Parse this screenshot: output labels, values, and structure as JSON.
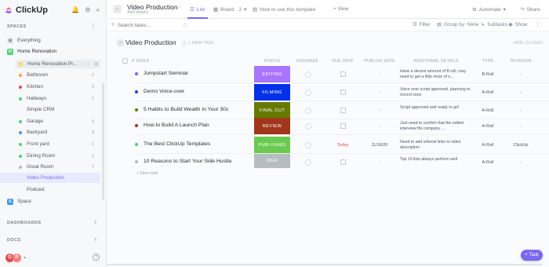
{
  "app": {
    "name": "ClickUp",
    "accent": "#7b68ee"
  },
  "sidebar": {
    "spaces_label": "SPACES",
    "everything": "Everything",
    "space_name": "Home Renovation",
    "space_initial": "H",
    "folder": "Home Renovation Pr...",
    "lists": [
      {
        "label": "Bathroom",
        "count": "2",
        "color": "#f9a33d"
      },
      {
        "label": "Kitchen",
        "count": "3",
        "color": "#e44c4c"
      },
      {
        "label": "Hallways",
        "count": "1",
        "color": "#4bd37b"
      },
      {
        "label": "Simple CRM",
        "count": "",
        "color": ""
      },
      {
        "label": "Garage",
        "count": "5",
        "color": "#4bd37b"
      },
      {
        "label": "Backyard",
        "count": "8",
        "color": "#4194f6"
      },
      {
        "label": "Front yard",
        "count": "1",
        "color": "#4bd37b"
      },
      {
        "label": "Dining Room",
        "count": "1",
        "color": "#4bd37b"
      },
      {
        "label": "Great Room",
        "count": "7",
        "color": ""
      },
      {
        "label": "Video Production",
        "count": "",
        "color": ""
      },
      {
        "label": "Podcast",
        "count": "",
        "color": ""
      }
    ],
    "space2_name": "Space",
    "space2_initial": "S",
    "dashboards_label": "DASHBOARDS",
    "docs_label": "DOCS",
    "avatar_initials": "O",
    "avatar2": "P"
  },
  "header": {
    "title": "Video Production",
    "subtitle": "Add details",
    "tab_list": "List",
    "tab_board": "Board",
    "tab_board_count": "2",
    "tab_howto": "How to use this template",
    "tab_view": "+ View",
    "automate": "Automate",
    "share": "Share"
  },
  "toolbar": {
    "search_placeholder": "Search tasks...",
    "filter": "Filter",
    "group_by": "Group by: None",
    "subtasks": "Subtasks",
    "show": "Show"
  },
  "list": {
    "group_title": "Video Production",
    "new_task_top": "+ NEW TASK",
    "hide_closed": "HIDE CLOSED",
    "columns": [
      "4 TASKS",
      "STATUS",
      "ASSIGNEE",
      "DUE DATE",
      "PUBLISH DATE",
      "ADDITIONAL DETAILS",
      "TYPE",
      "SPONSOR"
    ],
    "tasks": [
      {
        "name": "Jumpstart Seminar",
        "dot": "#7b68ee",
        "status": "EDITING",
        "status_color": "#a875ff",
        "due": "",
        "publish": "-",
        "details": "Have a decent amount of B-roll, may need to get a little more of s...",
        "type": "B-Roll",
        "sponsor": "-"
      },
      {
        "name": "Demo Voice-over",
        "dot": "#1e40d8",
        "status": "FILMING",
        "status_color": "#0231e8",
        "due": "",
        "publish": "-",
        "details": "Voice over script approved, planning to record soon",
        "type": "A-Roll",
        "sponsor": "-"
      },
      {
        "name": "5 Habits to Build Wealth In Your 30s",
        "dot": "#667a00",
        "status": "FINAL CUT",
        "status_color": "#667a00",
        "due": "",
        "publish": "-",
        "details": "Script approved and ready to go!",
        "type": "A-Roll",
        "sponsor": "-"
      },
      {
        "name": "How to Build A Launch Plan",
        "dot": "#a0361b",
        "status": "REVIEW",
        "status_color": "#a0361b",
        "due": "",
        "publish": "-",
        "details": "Just need to confirm that the edited interview fits company ...",
        "type": "A-Roll",
        "sponsor": "-"
      },
      {
        "name": "The Best ClickUp Templates",
        "dot": "#4bd37b",
        "status": "PUBLISHED",
        "status_color": "#6bc950",
        "due": "Today",
        "publish": "11/18/20",
        "details": "Need to add referral links to video description",
        "type": "A-Roll",
        "sponsor": "ClickUp"
      },
      {
        "name": "10 Reasons to Start Your Side Hustle",
        "dot": "#b5bcc2",
        "status": "IDEA",
        "status_color": "#b5bcc2",
        "due": "",
        "publish": "-",
        "details": "Top 10 lists always perform well",
        "type": "A-Roll",
        "sponsor": "-"
      }
    ],
    "new_task_bottom": "+ New task",
    "fab_label": "Task"
  }
}
